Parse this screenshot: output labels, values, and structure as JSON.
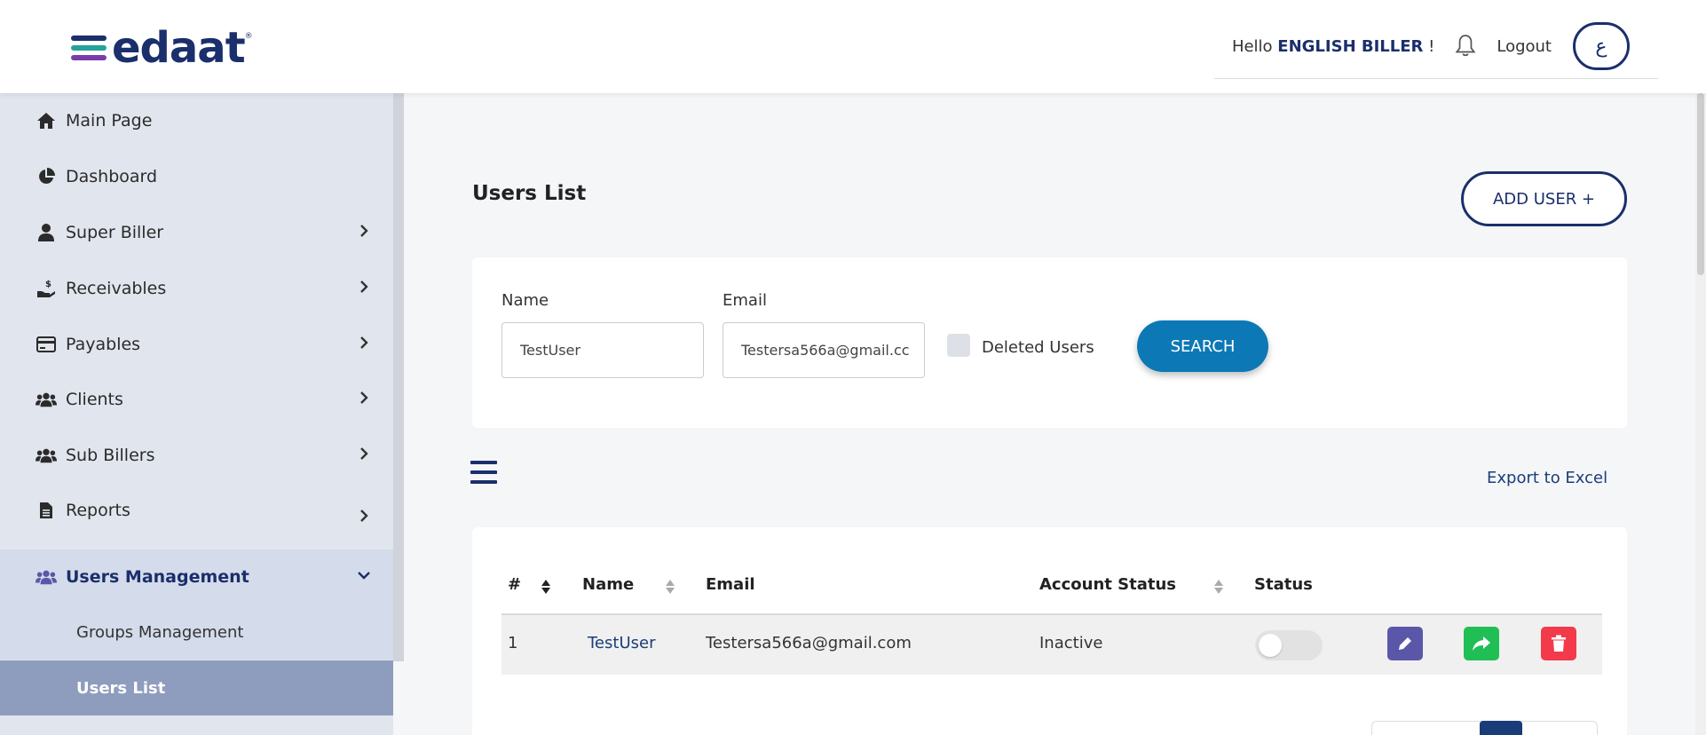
{
  "brand": {
    "name": "edaat",
    "registered": "®",
    "bar_colors": [
      "#1a2f6b",
      "#25a39a",
      "#7a3cab"
    ]
  },
  "header": {
    "hello_prefix": "Hello",
    "user_name": "ENGLISH BILLER",
    "hello_suffix": "!",
    "logout": "Logout",
    "language_toggle": "ع"
  },
  "sidebar": {
    "items": [
      {
        "label": "Main Page",
        "icon": "home-icon"
      },
      {
        "label": "Dashboard",
        "icon": "pie-chart-icon"
      },
      {
        "label": "Super Biller",
        "icon": "user-icon"
      },
      {
        "label": "Receivables",
        "icon": "hand-money-icon"
      },
      {
        "label": "Payables",
        "icon": "credit-card-icon"
      },
      {
        "label": "Clients",
        "icon": "users-icon"
      },
      {
        "label": "Sub Billers",
        "icon": "users-icon"
      },
      {
        "label": "Reports",
        "icon": "document-icon"
      },
      {
        "label": "Users Management",
        "icon": "users-icon"
      }
    ],
    "sub_items": [
      {
        "label": "Groups Management"
      },
      {
        "label": "Users List"
      }
    ]
  },
  "main": {
    "title": "Users List",
    "add_user": "ADD USER +",
    "filters": {
      "name_label": "Name",
      "name_value": "TestUser",
      "email_label": "Email",
      "email_value": "Testersa566a@gmail.cc",
      "deleted_users_label": "Deleted Users",
      "search": "SEARCH"
    },
    "export": "Export to Excel",
    "table": {
      "columns": [
        "#",
        "Name",
        "Email",
        "Account Status",
        "Status"
      ],
      "rows": [
        {
          "index": "1",
          "name": "TestUser",
          "email": "Testersa566a@gmail.com",
          "account_status": "Inactive",
          "status_on": false
        }
      ]
    }
  },
  "colors": {
    "primary": "#1a2f6b",
    "search_button": "#0c78b6",
    "edit_button": "#5b57a8",
    "share_button": "#1fbf55",
    "delete_button": "#f23a4a"
  }
}
